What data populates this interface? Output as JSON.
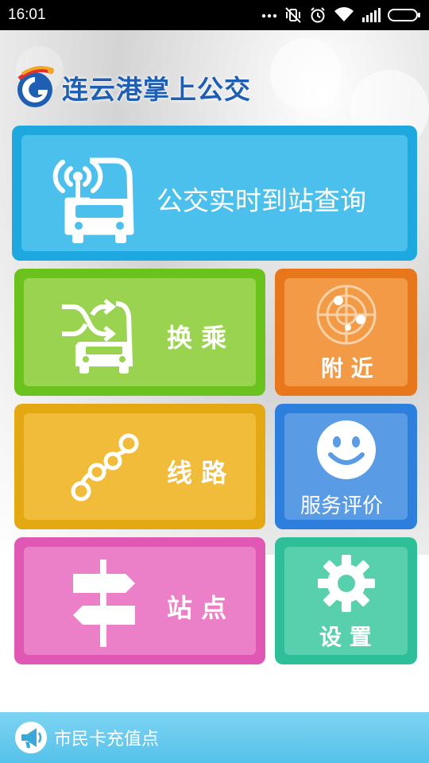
{
  "status_bar": {
    "time": "16:01",
    "icons": [
      "more-dots-icon",
      "vibrate-mute-icon",
      "alarm-icon",
      "wifi-icon",
      "signal-icon",
      "battery-icon"
    ]
  },
  "header": {
    "title": "连云港掌上公交",
    "logo": "bus-logo-icon"
  },
  "tiles": {
    "realtime": {
      "label": "公交实时到站查询",
      "icon": "bus-signal-icon",
      "color": "#1ea8e0",
      "inner_color": "#4cc0ec"
    },
    "transfer": {
      "label": "换 乘",
      "icon": "bus-transfer-icon",
      "color": "#6cc21c",
      "inner_color": "#9ad34f"
    },
    "nearby": {
      "label": "附 近",
      "icon": "radar-icon",
      "color": "#e8761a",
      "inner_color": "#f29a45"
    },
    "routes": {
      "label": "线 路",
      "icon": "route-nodes-icon",
      "color": "#e4a812",
      "inner_color": "#f0bc3a"
    },
    "feedback": {
      "label": "服务评价",
      "icon": "smiley-icon",
      "color": "#2c7fdc",
      "inner_color": "#5a9be6"
    },
    "stops": {
      "label": "站 点",
      "icon": "signpost-icon",
      "color": "#e058b4",
      "inner_color": "#ec80c8"
    },
    "settings": {
      "label": "设 置",
      "icon": "gear-icon",
      "color": "#2ebf98",
      "inner_color": "#58d0ae"
    }
  },
  "footer": {
    "label": "市民卡充值点",
    "icon": "megaphone-icon"
  }
}
